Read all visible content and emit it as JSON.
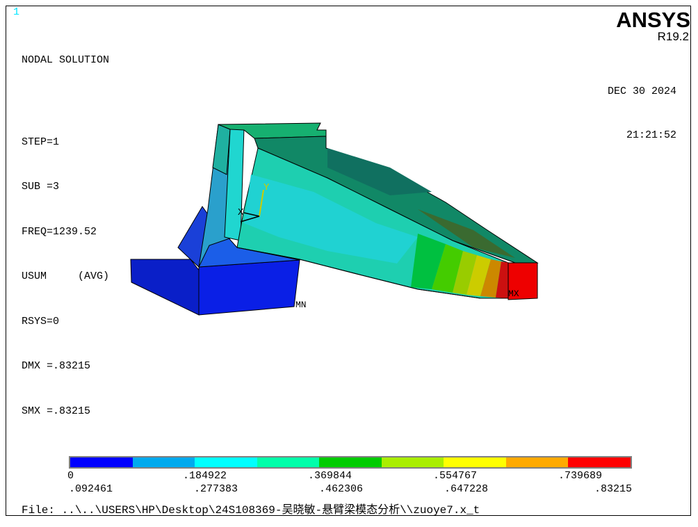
{
  "window_number": "1",
  "logo": {
    "name": "ANSYS",
    "version": "R19.2"
  },
  "info": {
    "title": "NODAL SOLUTION",
    "step": "STEP=1",
    "sub": "SUB =3",
    "freq": "FREQ=1239.52",
    "usum": "USUM     (AVG)",
    "rsys": "RSYS=0",
    "dmx": "DMX =.83215",
    "smx": "SMX =.83215"
  },
  "timestamp": {
    "date": "DEC 30 2024",
    "time": "21:21:52"
  },
  "labels": {
    "y_axis": "Y",
    "x_axis": "X",
    "min_marker": "MN",
    "max_marker": "MX"
  },
  "legend": {
    "colors": [
      "#0000ff",
      "#00aaee",
      "#00ffff",
      "#00ffaa",
      "#00cc00",
      "#aaee00",
      "#ffff00",
      "#ffaa00",
      "#ff0000"
    ],
    "ticks_top": [
      "0",
      ".184922",
      ".369844",
      ".554767",
      ".739689"
    ],
    "ticks_bottom": [
      ".092461",
      ".277383",
      ".462306",
      ".647228",
      ".83215"
    ]
  },
  "file_line": "File: ..\\..\\USERS\\HP\\Desktop\\24S108369-吴晓敏-悬臂梁模态分析\\\\zuoye7.x_t"
}
